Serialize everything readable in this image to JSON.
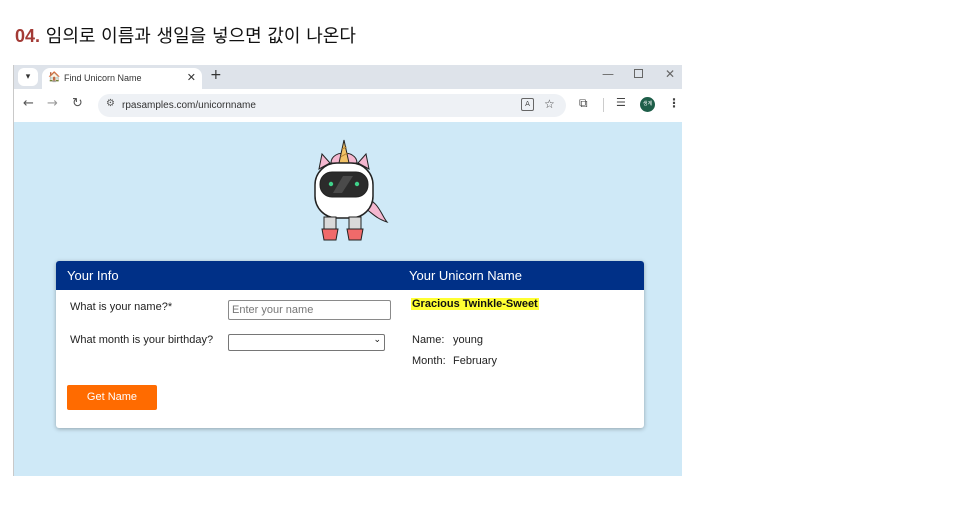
{
  "heading": {
    "number": "04.",
    "text": " 임의로 이름과 생일을 넣으면 값이 나온다"
  },
  "browser": {
    "tab_title": "Find Unicorn Name",
    "url": "rpasamples.com/unicornname",
    "avatar_text": "생계"
  },
  "card": {
    "left_header": "Your Info",
    "right_header": "Your Unicorn Name",
    "name_label": "What is your name?*",
    "name_placeholder": "Enter your name",
    "name_value": "",
    "month_label": "What month is your birthday?",
    "month_value": "",
    "button_label": "Get Name",
    "result_name": "Gracious Twinkle-Sweet",
    "name_key": "Name:",
    "name_result": "young",
    "month_key": "Month:",
    "month_result": "February"
  },
  "colors": {
    "header": "#003087",
    "button": "#ff6b00",
    "highlight": "#ffff33",
    "page_bg": "#cfe9f7"
  }
}
